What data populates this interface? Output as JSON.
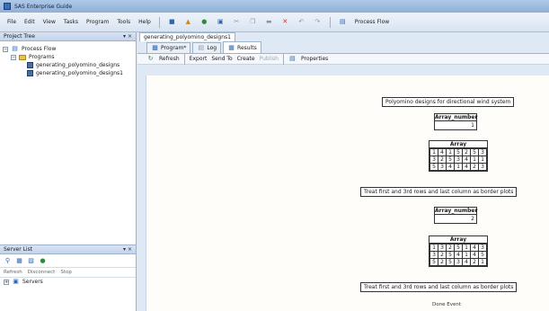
{
  "app": {
    "title": "SAS Enterprise Guide"
  },
  "menu": [
    "File",
    "Edit",
    "View",
    "Tasks",
    "Program",
    "Tools",
    "Help"
  ],
  "toolbar": {
    "process_flow": "Process Flow"
  },
  "project_tree": {
    "header": "Project Tree",
    "items": [
      {
        "label": "Process Flow",
        "level": 0
      },
      {
        "label": "Programs",
        "level": 1
      },
      {
        "label": "generating_polyomino_designs",
        "level": 2
      },
      {
        "label": "generating_polyomino_designs1",
        "level": 2
      }
    ]
  },
  "server_list": {
    "header": "Server List",
    "actions": [
      "Refresh",
      "Disconnect",
      "Stop"
    ],
    "items": [
      "Servers"
    ]
  },
  "document": {
    "tab": "generating_polyomino_designs1"
  },
  "tabs": [
    "Program*",
    "Log",
    "Results"
  ],
  "results_toolbar": [
    "Refresh",
    "Export",
    "Send To",
    "Create",
    "Publish",
    "Properties"
  ],
  "results": {
    "heading": "Polyomino designs for directional wind system",
    "designs": [
      {
        "var_label": "Array_number",
        "var_value": "1",
        "array_label": "Array",
        "grid": [
          [
            "1",
            "4",
            "1",
            "5",
            "2",
            "5",
            "3"
          ],
          [
            "3",
            "2",
            "5",
            "3",
            "4",
            "1",
            "1"
          ],
          [
            "5",
            "3",
            "4",
            "1",
            "4",
            "2",
            "3"
          ]
        ],
        "note": "Treat first and 3rd rows and last column as border plots"
      },
      {
        "var_label": "Array_number",
        "var_value": "2",
        "array_label": "Array",
        "grid": [
          [
            "1",
            "3",
            "2",
            "5",
            "1",
            "4",
            "3"
          ],
          [
            "3",
            "2",
            "5",
            "4",
            "1",
            "4",
            "5"
          ],
          [
            "5",
            "2",
            "5",
            "3",
            "4",
            "2",
            "1"
          ]
        ],
        "note": "Treat first and 3rd rows and last column as border plots"
      }
    ],
    "footer": "Done Event"
  }
}
